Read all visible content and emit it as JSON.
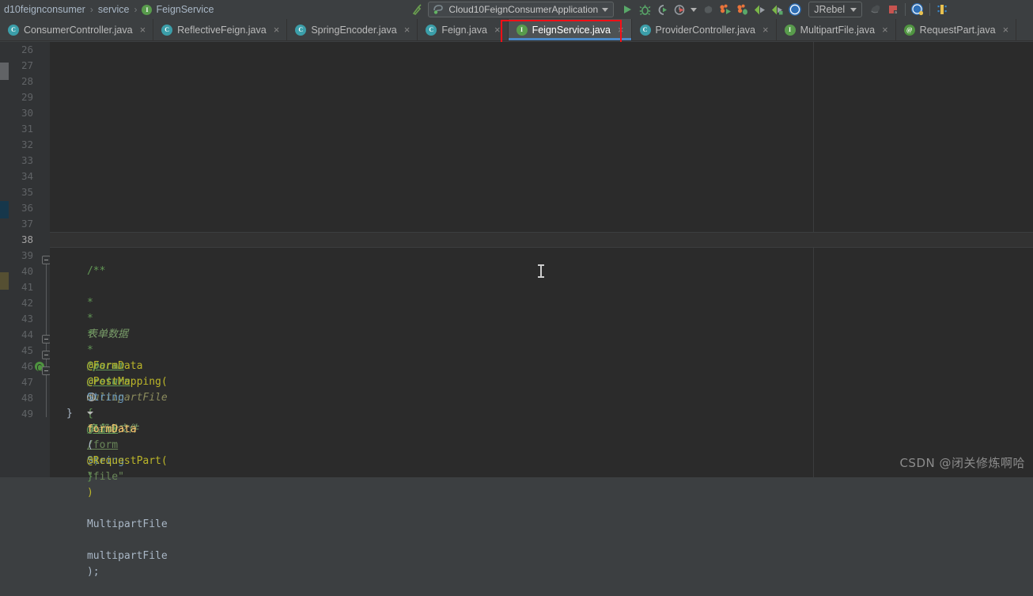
{
  "toolbar": {
    "breadcrumb": [
      {
        "label": "d10feignconsumer",
        "icon": ""
      },
      {
        "label": "service",
        "icon": ""
      },
      {
        "label": "FeignService",
        "icon": "interface-icon",
        "badge": "I"
      }
    ],
    "separator": "›",
    "hammer_icon": "build-hammer-icon",
    "run_config": {
      "name": "Cloud10FeignConsumerApplication",
      "icon": "spring-boot-icon",
      "dropdown": "chevron-down-icon"
    },
    "actions": [
      {
        "name": "run-button",
        "icon": "run-icon"
      },
      {
        "name": "debug-button",
        "icon": "debug-bug-icon"
      },
      {
        "name": "run-with-coverage-button",
        "icon": "coverage-icon"
      },
      {
        "name": "profiler-button",
        "icon": "profiler-icon"
      },
      {
        "name": "profiler-dropdown",
        "icon": "chevron-down-icon"
      },
      {
        "name": "stop-button",
        "icon": "stop-icon"
      },
      {
        "name": "jrebel-run-button",
        "icon": "jrebel-run-icon"
      },
      {
        "name": "jrebel-debug-button",
        "icon": "jrebel-debug-icon"
      },
      {
        "name": "xrebel-run-button",
        "icon": "xrebel-run-icon"
      },
      {
        "name": "xrebel-debug-button",
        "icon": "xrebel-debug-icon"
      },
      {
        "name": "jrebel-settings-button",
        "icon": "jrebel-compass-icon"
      }
    ],
    "jrebel": {
      "label": "JRebel",
      "dropdown": "chevron-down-icon"
    },
    "trailing": [
      {
        "name": "update-running-app-button",
        "icon": "update-app-icon"
      },
      {
        "name": "stop-application-button",
        "icon": "stop-square-icon"
      },
      {
        "name": "search-everywhere-button",
        "icon": "compass-icon"
      },
      {
        "name": "layout-button",
        "icon": "layout-icon"
      }
    ]
  },
  "tabs": [
    {
      "label": "ConsumerController.java",
      "icon": "class-icon",
      "badge": "C",
      "kind": "c",
      "locked": false,
      "active": false,
      "close": "×"
    },
    {
      "label": "ReflectiveFeign.java",
      "icon": "class-icon",
      "badge": "C",
      "kind": "c",
      "locked": true,
      "active": false,
      "close": "×"
    },
    {
      "label": "SpringEncoder.java",
      "icon": "class-icon",
      "badge": "C",
      "kind": "c",
      "locked": true,
      "active": false,
      "close": "×"
    },
    {
      "label": "Feign.java",
      "icon": "class-icon",
      "badge": "C",
      "kind": "c",
      "locked": true,
      "active": false,
      "close": "×"
    },
    {
      "label": "FeignService.java",
      "icon": "interface-icon",
      "badge": "I",
      "kind": "i",
      "locked": false,
      "active": true,
      "close": "×"
    },
    {
      "label": "ProviderController.java",
      "icon": "class-icon",
      "badge": "C",
      "kind": "c",
      "locked": false,
      "active": false,
      "close": "×"
    },
    {
      "label": "MultipartFile.java",
      "icon": "interface-icon",
      "badge": "I",
      "kind": "i",
      "locked": true,
      "active": false,
      "close": "×"
    },
    {
      "label": "RequestPart.java",
      "icon": "annotation-icon",
      "badge": "@",
      "kind": "a",
      "locked": true,
      "active": false,
      "close": "×"
    }
  ],
  "editor": {
    "first_line": 26,
    "last_line": 49,
    "caret_line": 38,
    "highlight_color": "#fa0f16",
    "active_tab_underline": "#4a88c7",
    "lines": [
      {
        "n": 26,
        "text": ""
      },
      {
        "n": 27,
        "text": ""
      },
      {
        "n": 28,
        "text": ""
      },
      {
        "n": 29,
        "text": ""
      },
      {
        "n": 30,
        "text": ""
      },
      {
        "n": 31,
        "text": ""
      },
      {
        "n": 32,
        "text": ""
      },
      {
        "n": 33,
        "text": ""
      },
      {
        "n": 34,
        "text": ""
      },
      {
        "n": 35,
        "text": ""
      },
      {
        "n": 36,
        "text": ""
      },
      {
        "n": 37,
        "text": ""
      },
      {
        "n": 38,
        "text": ""
      },
      {
        "n": 39,
        "text": "    /**"
      },
      {
        "n": 40,
        "text": "     * 表单数据"
      },
      {
        "n": 41,
        "text": "     *"
      },
      {
        "n": 42,
        "text": "     * @param multipartFile 多部分文件"
      },
      {
        "n": 43,
        "text": "     * @return {@link String}"
      },
      {
        "n": 44,
        "text": "     */"
      },
      {
        "n": 45,
        "text": "    @FormData"
      },
      {
        "n": 46,
        "text": "    @PostMapping(\"/form\")"
      },
      {
        "n": 47,
        "text": "    String formData(@RequestPart(\"file\") MultipartFile multipartFile);"
      },
      {
        "n": 48,
        "text": "}"
      },
      {
        "n": 49,
        "text": ""
      }
    ],
    "javadoc": {
      "open": "/**",
      "star": "*",
      "summary": "表单数据",
      "param_tag": "@param",
      "param_name": "multipartFile",
      "param_desc": "多部分文件",
      "return_tag": "@return",
      "link_open": "{",
      "link_tag": "@link",
      "link_type": "String",
      "link_close": "}",
      "close": "*/"
    },
    "code": {
      "ann_formdata": "@FormData",
      "ann_postmapping": "@PostMapping(",
      "postmapping_quote_open": "\"",
      "postmapping_path": "/form",
      "postmapping_quote_close": "\")",
      "ret_type": "String",
      "method_name": "formData",
      "paren_open": "(",
      "ann_requestpart": "@RequestPart(",
      "requestpart_value": "\"file\"",
      "requestpart_close": ")",
      "param_type": "MultipartFile",
      "param_var": "multipartFile",
      "paren_close": ");",
      "brace_close": "}"
    },
    "gutter_icon": "implementing-method-icon"
  },
  "watermark": "CSDN @闭关修炼啊哈"
}
